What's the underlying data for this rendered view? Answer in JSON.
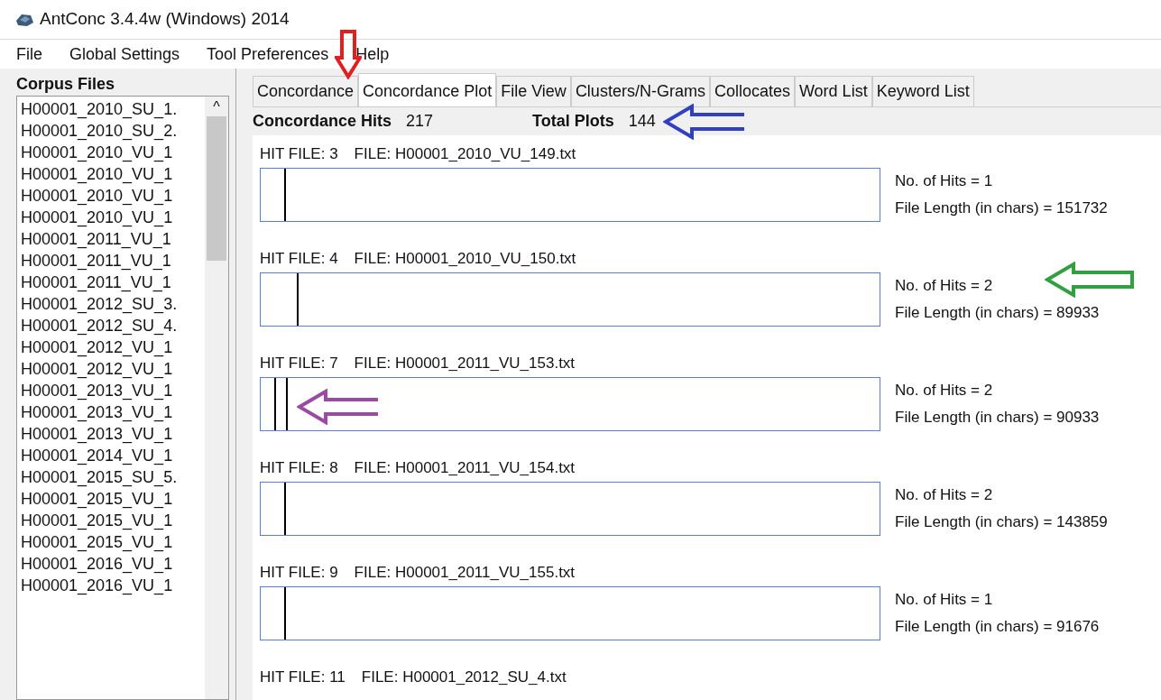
{
  "window": {
    "title": "AntConc 3.4.4w (Windows) 2014"
  },
  "menu": [
    "File",
    "Global Settings",
    "Tool Preferences",
    "Help"
  ],
  "sidebar": {
    "title": "Corpus Files",
    "scroll_up": "^",
    "items": [
      "H00001_2010_SU_1.",
      "H00001_2010_SU_2.",
      "H00001_2010_VU_1",
      "H00001_2010_VU_1",
      "H00001_2010_VU_1",
      "H00001_2010_VU_1",
      "H00001_2011_VU_1",
      "H00001_2011_VU_1",
      "H00001_2011_VU_1",
      "H00001_2012_SU_3.",
      "H00001_2012_SU_4.",
      "H00001_2012_VU_1",
      "H00001_2012_VU_1",
      "H00001_2013_VU_1",
      "H00001_2013_VU_1",
      "H00001_2013_VU_1",
      "H00001_2014_VU_1",
      "H00001_2015_SU_5.",
      "H00001_2015_VU_1",
      "H00001_2015_VU_1",
      "H00001_2015_VU_1",
      "H00001_2016_VU_1",
      "H00001_2016_VU_1"
    ]
  },
  "tabs": [
    {
      "label": "Concordance",
      "selected": false
    },
    {
      "label": "Concordance Plot",
      "selected": true,
      "down_arrow": {
        "color": "#e02020"
      }
    },
    {
      "label": "File View",
      "selected": false
    },
    {
      "label": "Clusters/N-Grams",
      "selected": false
    },
    {
      "label": "Collocates",
      "selected": false
    },
    {
      "label": "Word List",
      "selected": false
    },
    {
      "label": "Keyword List",
      "selected": false
    }
  ],
  "summary": {
    "hits_label": "Concordance Hits",
    "hits": "217",
    "plots_label": "Total Plots",
    "plots": "144",
    "left_arrow": {
      "color": "#3040c0"
    }
  },
  "plots": [
    {
      "hit_file": "HIT FILE: 3",
      "file": "FILE: H00001_2010_VU_149.txt",
      "hits": [
        {
          "level": 0.038
        }
      ],
      "no_hits": "No. of Hits = 1",
      "length": "File Length (in chars) = 151732"
    },
    {
      "hit_file": "HIT FILE: 4",
      "file": "FILE: H00001_2010_VU_150.txt",
      "hits": [
        {
          "level": 0.058
        }
      ],
      "no_hits": "No. of Hits = 2",
      "length": "File Length (in chars) = 89933",
      "info_arrow": {
        "color": "#30a040"
      }
    },
    {
      "hit_file": "HIT FILE: 7",
      "file": "FILE: H00001_2011_VU_153.txt",
      "hits": [
        {
          "level": 0.022
        },
        {
          "level": 0.041
        }
      ],
      "no_hits": "No. of Hits = 2",
      "length": "File Length (in chars) = 90933",
      "plot_arrow": {
        "color": "#9a4aa0"
      }
    },
    {
      "hit_file": "HIT FILE: 8",
      "file": "FILE: H00001_2011_VU_154.txt",
      "hits": [
        {
          "level": 0.038
        }
      ],
      "no_hits": "No. of Hits = 2",
      "length": "File Length (in chars) = 143859"
    },
    {
      "hit_file": "HIT FILE: 9",
      "file": "FILE: H00001_2011_VU_155.txt",
      "hits": [
        {
          "level": 0.038
        }
      ],
      "no_hits": "No. of Hits = 1",
      "length": "File Length (in chars) = 91676"
    },
    {
      "hit_file": "HIT FILE: 11",
      "file": "FILE: H00001_2012_SU_4.txt"
    }
  ]
}
